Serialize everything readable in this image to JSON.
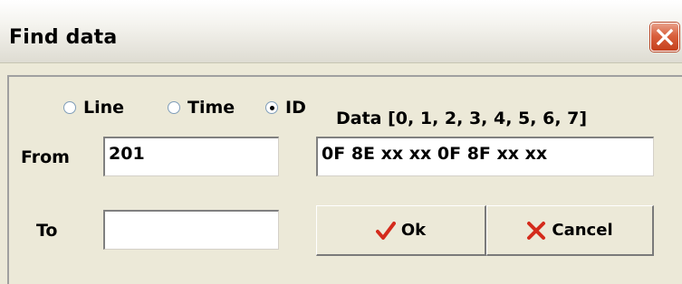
{
  "window": {
    "title": "Find data"
  },
  "mode": {
    "options": [
      {
        "label": "Line",
        "checked": false
      },
      {
        "label": "Time",
        "checked": false
      },
      {
        "label": "ID",
        "checked": true
      }
    ]
  },
  "data_field": {
    "label": "Data [0, 1, 2, 3, 4, 5, 6, 7]",
    "value": "0F 8E xx xx 0F 8F xx xx"
  },
  "from_field": {
    "label": "From",
    "value": "201"
  },
  "to_field": {
    "label": "To",
    "value": ""
  },
  "buttons": {
    "ok_label": "Ok",
    "cancel_label": "Cancel"
  },
  "icons": {
    "close": "close-icon",
    "ok": "checkmark-icon",
    "cancel": "cross-icon"
  },
  "colors": {
    "close_button": "#d9603d",
    "ok_icon": "#d42b1c",
    "cancel_icon": "#d42b1c",
    "dialog_background": "#ece9d8"
  }
}
